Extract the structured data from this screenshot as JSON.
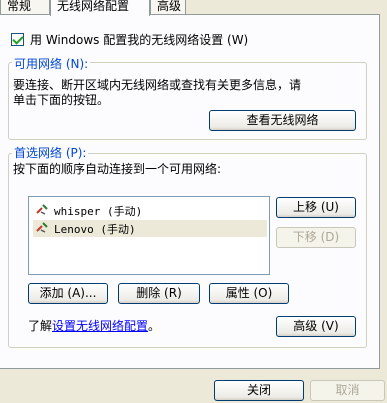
{
  "tabs": [
    "常规",
    "无线网络配置",
    "高级"
  ],
  "use_windows_label": "用 Windows 配置我的无线网络设置 (W)",
  "use_windows_checked": true,
  "available": {
    "legend": "可用网络 (N):",
    "desc_line1": "要连接、断开区域内无线网络或查找有关更多信息，请",
    "desc_line2": "单击下面的按钮。",
    "view_button": "查看无线网络"
  },
  "preferred": {
    "legend": "首选网络 (P):",
    "desc": "按下面的顺序自动连接到一个可用网络:",
    "networks": [
      "whisper (手动)",
      "Lenovo (手动)"
    ],
    "selected_index": 1,
    "up_button": "上移 (U)",
    "down_button": "下移 (D)",
    "add_button": "添加 (A)...",
    "delete_button": "删除 (R)",
    "properties_button": "属性 (O)"
  },
  "learn": {
    "prefix": "了解",
    "link": "设置无线网络配置",
    "suffix": "。"
  },
  "advanced_button": "高级 (V)",
  "close_button": "关闭",
  "cancel_button": "取消"
}
